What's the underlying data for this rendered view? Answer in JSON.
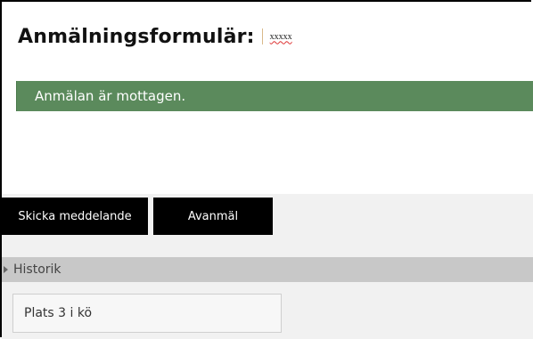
{
  "form": {
    "title": "Anmälningsformulär:",
    "title_value": "xxxxx"
  },
  "alert": {
    "message": "Anmälan är mottagen.",
    "color": "#5b8a5c"
  },
  "actions": {
    "send_label": "Skicka meddelande",
    "cancel_label": "Avanmäl"
  },
  "history": {
    "label": "Historik",
    "entries": [
      "Plats 3 i kö"
    ]
  }
}
